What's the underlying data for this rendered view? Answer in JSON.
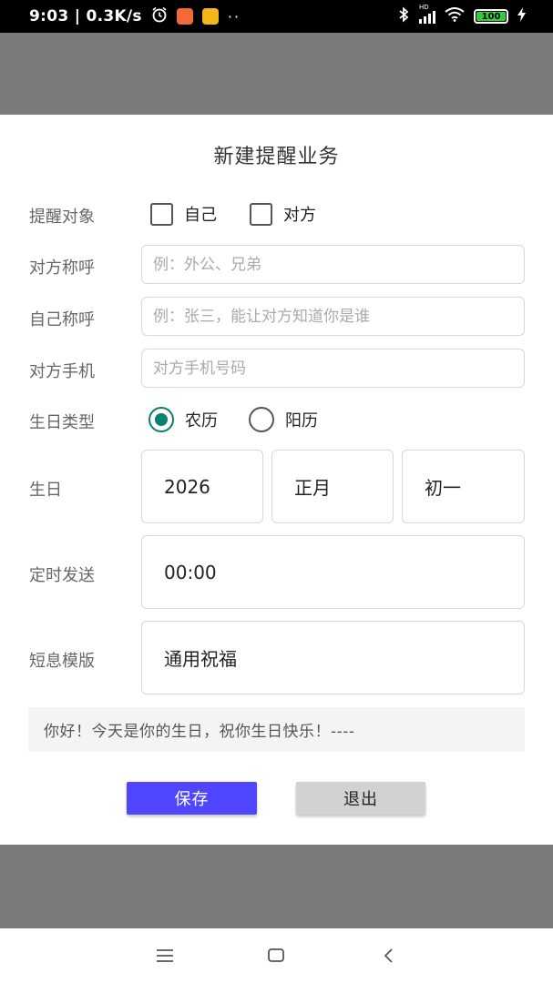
{
  "status_bar": {
    "time": "9:03",
    "speed": "0.3K/s",
    "dots": "··",
    "hd": "HD",
    "battery": "100",
    "colors": {
      "app1": "#f26a3a",
      "app2": "#f5b619",
      "battery_fill": "#2fd03a"
    }
  },
  "dialog": {
    "title": "新建提醒业务",
    "target": {
      "label": "提醒对象",
      "options": [
        {
          "label": "自己",
          "checked": false
        },
        {
          "label": "对方",
          "checked": false
        }
      ]
    },
    "other_name": {
      "label": "对方称呼",
      "value": "",
      "placeholder": "例：外公、兄弟"
    },
    "self_name": {
      "label": "自己称呼",
      "value": "",
      "placeholder": "例：张三，能让对方知道你是谁"
    },
    "other_phone": {
      "label": "对方手机",
      "value": "",
      "placeholder": "对方手机号码"
    },
    "birthday_type": {
      "label": "生日类型",
      "options": [
        {
          "label": "农历",
          "selected": true
        },
        {
          "label": "阳历",
          "selected": false
        }
      ],
      "accent_color": "#0a7f73"
    },
    "birthday": {
      "label": "生日",
      "year": "2026",
      "month": "正月",
      "day": "初一"
    },
    "send_time": {
      "label": "定时发送",
      "value": "00:00"
    },
    "template": {
      "label": "短息模版",
      "value": "通用祝福"
    },
    "preview_text": "你好！今天是你的生日，祝你生日快乐！----",
    "buttons": {
      "save": "保存",
      "exit": "退出"
    },
    "colors": {
      "save_bg": "#5046ff",
      "exit_bg": "#d2d2d2"
    }
  },
  "nav_bar": {
    "icons": [
      "menu-icon",
      "home-icon",
      "back-icon"
    ]
  }
}
